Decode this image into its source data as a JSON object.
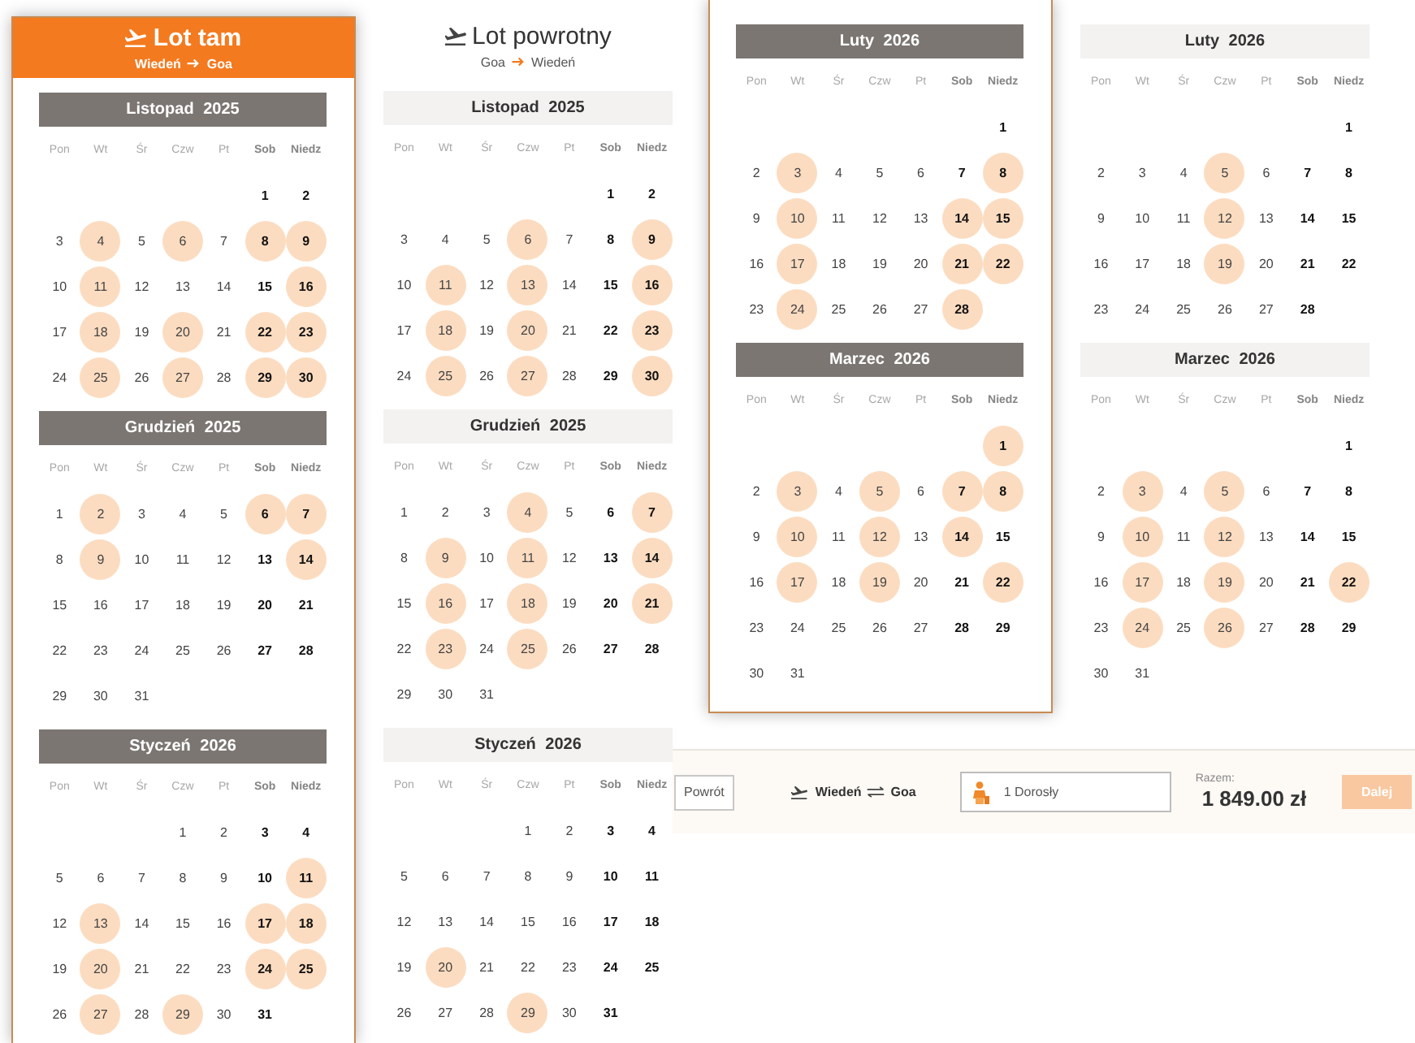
{
  "panels": [
    {
      "title": "Lot tam",
      "route": {
        "from": "Wiedeń",
        "to": "Goa"
      },
      "selected": true,
      "months": [
        {
          "title": "Listopad 2025",
          "weekdays": [
            "Pon",
            "Wt",
            "Śr",
            "Czw",
            "Pt",
            "Sob",
            "Niedz"
          ],
          "weeks": [
            [
              {
                "day": "1",
                "available": false
              },
              {
                "day": "2",
                "available": false
              }
            ],
            [
              {
                "day": "3",
                "available": false
              },
              {
                "day": "4",
                "available": true
              },
              {
                "day": "5",
                "available": false
              },
              {
                "day": "6",
                "available": true
              },
              {
                "day": "7",
                "available": false
              },
              {
                "day": "8",
                "available": true
              },
              {
                "day": "9",
                "available": true
              }
            ],
            [
              {
                "day": "10",
                "available": false
              },
              {
                "day": "11",
                "available": true
              },
              {
                "day": "12",
                "available": false
              },
              {
                "day": "13",
                "available": false
              },
              {
                "day": "14",
                "available": false
              },
              {
                "day": "15",
                "available": false
              },
              {
                "day": "16",
                "available": true
              }
            ],
            [
              {
                "day": "17",
                "available": false
              },
              {
                "day": "18",
                "available": true
              },
              {
                "day": "19",
                "available": false
              },
              {
                "day": "20",
                "available": true
              },
              {
                "day": "21",
                "available": false
              },
              {
                "day": "22",
                "available": true
              },
              {
                "day": "23",
                "available": true
              }
            ],
            [
              {
                "day": "24",
                "available": false
              },
              {
                "day": "25",
                "available": true
              },
              {
                "day": "26",
                "available": false
              },
              {
                "day": "27",
                "available": true
              },
              {
                "day": "28",
                "available": false
              },
              {
                "day": "29",
                "available": true
              },
              {
                "day": "30",
                "available": true
              }
            ]
          ]
        },
        {
          "title": "Grudzień 2025",
          "weekdays": [
            "Pon",
            "Wt",
            "Śr",
            "Czw",
            "Pt",
            "Sob",
            "Niedz"
          ],
          "weeks": [
            [
              {
                "day": "1",
                "available": false
              },
              {
                "day": "2",
                "available": true
              },
              {
                "day": "3",
                "available": false
              },
              {
                "day": "4",
                "available": false
              },
              {
                "day": "5",
                "available": false
              },
              {
                "day": "6",
                "available": true
              },
              {
                "day": "7",
                "available": true
              }
            ],
            [
              {
                "day": "8",
                "available": false
              },
              {
                "day": "9",
                "available": true
              },
              {
                "day": "10",
                "available": false
              },
              {
                "day": "11",
                "available": false
              },
              {
                "day": "12",
                "available": false
              },
              {
                "day": "13",
                "available": false
              },
              {
                "day": "14",
                "available": true
              }
            ],
            [
              {
                "day": "15",
                "available": false
              },
              {
                "day": "16",
                "available": false
              },
              {
                "day": "17",
                "available": false
              },
              {
                "day": "18",
                "available": false
              },
              {
                "day": "19",
                "available": false
              },
              {
                "day": "20",
                "available": false
              },
              {
                "day": "21",
                "available": false
              }
            ],
            [
              {
                "day": "22",
                "available": false
              },
              {
                "day": "23",
                "available": false
              },
              {
                "day": "24",
                "available": false
              },
              {
                "day": "25",
                "available": false
              },
              {
                "day": "26",
                "available": false
              },
              {
                "day": "27",
                "available": false
              },
              {
                "day": "28",
                "available": false
              }
            ],
            [
              {
                "day": "29",
                "available": false
              },
              {
                "day": "30",
                "available": false
              },
              {
                "day": "31",
                "available": false
              }
            ]
          ]
        },
        {
          "title": "Styczeń 2026",
          "weekdays": [
            "Pon",
            "Wt",
            "Śr",
            "Czw",
            "Pt",
            "Sob",
            "Niedz"
          ],
          "weeks": [
            [
              {
                "day": "1",
                "available": false
              },
              {
                "day": "2",
                "available": false
              },
              {
                "day": "3",
                "available": false
              },
              {
                "day": "4",
                "available": false
              }
            ],
            [
              {
                "day": "5",
                "available": false
              },
              {
                "day": "6",
                "available": false
              },
              {
                "day": "7",
                "available": false
              },
              {
                "day": "8",
                "available": false
              },
              {
                "day": "9",
                "available": false
              },
              {
                "day": "10",
                "available": false
              },
              {
                "day": "11",
                "available": true
              }
            ],
            [
              {
                "day": "12",
                "available": false
              },
              {
                "day": "13",
                "available": true
              },
              {
                "day": "14",
                "available": false
              },
              {
                "day": "15",
                "available": false
              },
              {
                "day": "16",
                "available": false
              },
              {
                "day": "17",
                "available": true
              },
              {
                "day": "18",
                "available": true
              }
            ],
            [
              {
                "day": "19",
                "available": false
              },
              {
                "day": "20",
                "available": true
              },
              {
                "day": "21",
                "available": false
              },
              {
                "day": "22",
                "available": false
              },
              {
                "day": "23",
                "available": false
              },
              {
                "day": "24",
                "available": true
              },
              {
                "day": "25",
                "available": true
              }
            ],
            [
              {
                "day": "26",
                "available": false
              },
              {
                "day": "27",
                "available": true
              },
              {
                "day": "28",
                "available": false
              },
              {
                "day": "29",
                "available": true
              },
              {
                "day": "30",
                "available": false
              },
              {
                "day": "31",
                "available": false
              }
            ]
          ]
        }
      ]
    },
    {
      "title": "Lot powrotny",
      "route": {
        "from": "Goa",
        "to": "Wiedeń"
      },
      "selected": false,
      "months": [
        {
          "title": "Listopad 2025",
          "weekdays": [
            "Pon",
            "Wt",
            "Śr",
            "Czw",
            "Pt",
            "Sob",
            "Niedz"
          ],
          "weeks": [
            [
              {
                "day": "1",
                "available": false
              },
              {
                "day": "2",
                "available": false
              }
            ],
            [
              {
                "day": "3",
                "available": false
              },
              {
                "day": "4",
                "available": false
              },
              {
                "day": "5",
                "available": false
              },
              {
                "day": "6",
                "available": true
              },
              {
                "day": "7",
                "available": false
              },
              {
                "day": "8",
                "available": false
              },
              {
                "day": "9",
                "available": true
              }
            ],
            [
              {
                "day": "10",
                "available": false
              },
              {
                "day": "11",
                "available": true
              },
              {
                "day": "12",
                "available": false
              },
              {
                "day": "13",
                "available": true
              },
              {
                "day": "14",
                "available": false
              },
              {
                "day": "15",
                "available": false
              },
              {
                "day": "16",
                "available": true
              }
            ],
            [
              {
                "day": "17",
                "available": false
              },
              {
                "day": "18",
                "available": true
              },
              {
                "day": "19",
                "available": false
              },
              {
                "day": "20",
                "available": true
              },
              {
                "day": "21",
                "available": false
              },
              {
                "day": "22",
                "available": false
              },
              {
                "day": "23",
                "available": true
              }
            ],
            [
              {
                "day": "24",
                "available": false
              },
              {
                "day": "25",
                "available": true
              },
              {
                "day": "26",
                "available": false
              },
              {
                "day": "27",
                "available": true
              },
              {
                "day": "28",
                "available": false
              },
              {
                "day": "29",
                "available": false
              },
              {
                "day": "30",
                "available": true
              }
            ]
          ]
        },
        {
          "title": "Grudzień 2025",
          "weekdays": [
            "Pon",
            "Wt",
            "Śr",
            "Czw",
            "Pt",
            "Sob",
            "Niedz"
          ],
          "weeks": [
            [
              {
                "day": "1",
                "available": false
              },
              {
                "day": "2",
                "available": false
              },
              {
                "day": "3",
                "available": false
              },
              {
                "day": "4",
                "available": true
              },
              {
                "day": "5",
                "available": false
              },
              {
                "day": "6",
                "available": false
              },
              {
                "day": "7",
                "available": true
              }
            ],
            [
              {
                "day": "8",
                "available": false
              },
              {
                "day": "9",
                "available": true
              },
              {
                "day": "10",
                "available": false
              },
              {
                "day": "11",
                "available": true
              },
              {
                "day": "12",
                "available": false
              },
              {
                "day": "13",
                "available": false
              },
              {
                "day": "14",
                "available": true
              }
            ],
            [
              {
                "day": "15",
                "available": false
              },
              {
                "day": "16",
                "available": true
              },
              {
                "day": "17",
                "available": false
              },
              {
                "day": "18",
                "available": true
              },
              {
                "day": "19",
                "available": false
              },
              {
                "day": "20",
                "available": false
              },
              {
                "day": "21",
                "available": true
              }
            ],
            [
              {
                "day": "22",
                "available": false
              },
              {
                "day": "23",
                "available": true
              },
              {
                "day": "24",
                "available": false
              },
              {
                "day": "25",
                "available": true
              },
              {
                "day": "26",
                "available": false
              },
              {
                "day": "27",
                "available": false
              },
              {
                "day": "28",
                "available": false
              }
            ],
            [
              {
                "day": "29",
                "available": false
              },
              {
                "day": "30",
                "available": false
              },
              {
                "day": "31",
                "available": false
              }
            ]
          ]
        },
        {
          "title": "Styczeń 2026",
          "weekdays": [
            "Pon",
            "Wt",
            "Śr",
            "Czw",
            "Pt",
            "Sob",
            "Niedz"
          ],
          "weeks": [
            [
              {
                "day": "1",
                "available": false
              },
              {
                "day": "2",
                "available": false
              },
              {
                "day": "3",
                "available": false
              },
              {
                "day": "4",
                "available": false
              }
            ],
            [
              {
                "day": "5",
                "available": false
              },
              {
                "day": "6",
                "available": false
              },
              {
                "day": "7",
                "available": false
              },
              {
                "day": "8",
                "available": false
              },
              {
                "day": "9",
                "available": false
              },
              {
                "day": "10",
                "available": false
              },
              {
                "day": "11",
                "available": false
              }
            ],
            [
              {
                "day": "12",
                "available": false
              },
              {
                "day": "13",
                "available": false
              },
              {
                "day": "14",
                "available": false
              },
              {
                "day": "15",
                "available": false
              },
              {
                "day": "16",
                "available": false
              },
              {
                "day": "17",
                "available": false
              },
              {
                "day": "18",
                "available": false
              }
            ],
            [
              {
                "day": "19",
                "available": false
              },
              {
                "day": "20",
                "available": true
              },
              {
                "day": "21",
                "available": false
              },
              {
                "day": "22",
                "available": false
              },
              {
                "day": "23",
                "available": false
              },
              {
                "day": "24",
                "available": false
              },
              {
                "day": "25",
                "available": false
              }
            ],
            [
              {
                "day": "26",
                "available": false
              },
              {
                "day": "27",
                "available": false
              },
              {
                "day": "28",
                "available": false
              },
              {
                "day": "29",
                "available": true
              },
              {
                "day": "30",
                "available": false
              },
              {
                "day": "31",
                "available": false
              }
            ]
          ]
        }
      ]
    },
    {
      "selected": true,
      "months": [
        {
          "title": "Luty 2026",
          "weekdays": [
            "Pon",
            "Wt",
            "Śr",
            "Czw",
            "Pt",
            "Sob",
            "Niedz"
          ],
          "weeks": [
            [
              {
                "day": "1",
                "available": false
              }
            ],
            [
              {
                "day": "2",
                "available": false
              },
              {
                "day": "3",
                "available": true
              },
              {
                "day": "4",
                "available": false
              },
              {
                "day": "5",
                "available": false
              },
              {
                "day": "6",
                "available": false
              },
              {
                "day": "7",
                "available": false
              },
              {
                "day": "8",
                "available": true
              }
            ],
            [
              {
                "day": "9",
                "available": false
              },
              {
                "day": "10",
                "available": true
              },
              {
                "day": "11",
                "available": false
              },
              {
                "day": "12",
                "available": false
              },
              {
                "day": "13",
                "available": false
              },
              {
                "day": "14",
                "available": true
              },
              {
                "day": "15",
                "available": true
              }
            ],
            [
              {
                "day": "16",
                "available": false
              },
              {
                "day": "17",
                "available": true
              },
              {
                "day": "18",
                "available": false
              },
              {
                "day": "19",
                "available": false
              },
              {
                "day": "20",
                "available": false
              },
              {
                "day": "21",
                "available": true
              },
              {
                "day": "22",
                "available": true
              }
            ],
            [
              {
                "day": "23",
                "available": false
              },
              {
                "day": "24",
                "available": true
              },
              {
                "day": "25",
                "available": false
              },
              {
                "day": "26",
                "available": false
              },
              {
                "day": "27",
                "available": false
              },
              {
                "day": "28",
                "available": true
              }
            ]
          ]
        },
        {
          "title": "Marzec 2026",
          "weekdays": [
            "Pon",
            "Wt",
            "Śr",
            "Czw",
            "Pt",
            "Sob",
            "Niedz"
          ],
          "weeks": [
            [
              {
                "day": "1",
                "available": true
              }
            ],
            [
              {
                "day": "2",
                "available": false
              },
              {
                "day": "3",
                "available": true
              },
              {
                "day": "4",
                "available": false
              },
              {
                "day": "5",
                "available": true
              },
              {
                "day": "6",
                "available": false
              },
              {
                "day": "7",
                "available": true
              },
              {
                "day": "8",
                "available": true
              }
            ],
            [
              {
                "day": "9",
                "available": false
              },
              {
                "day": "10",
                "available": true
              },
              {
                "day": "11",
                "available": false
              },
              {
                "day": "12",
                "available": true
              },
              {
                "day": "13",
                "available": false
              },
              {
                "day": "14",
                "available": true
              },
              {
                "day": "15",
                "available": false
              }
            ],
            [
              {
                "day": "16",
                "available": false
              },
              {
                "day": "17",
                "available": true
              },
              {
                "day": "18",
                "available": false
              },
              {
                "day": "19",
                "available": true
              },
              {
                "day": "20",
                "available": false
              },
              {
                "day": "21",
                "available": false
              },
              {
                "day": "22",
                "available": true
              }
            ],
            [
              {
                "day": "23",
                "available": false
              },
              {
                "day": "24",
                "available": false
              },
              {
                "day": "25",
                "available": false
              },
              {
                "day": "26",
                "available": false
              },
              {
                "day": "27",
                "available": false
              },
              {
                "day": "28",
                "available": false
              },
              {
                "day": "29",
                "available": false
              }
            ],
            [
              {
                "day": "30",
                "available": false
              },
              {
                "day": "31",
                "available": false
              }
            ]
          ]
        }
      ]
    },
    {
      "selected": false,
      "months": [
        {
          "title": "Luty 2026",
          "weekdays": [
            "Pon",
            "Wt",
            "Śr",
            "Czw",
            "Pt",
            "Sob",
            "Niedz"
          ],
          "weeks": [
            [
              {
                "day": "1",
                "available": false
              }
            ],
            [
              {
                "day": "2",
                "available": false
              },
              {
                "day": "3",
                "available": false
              },
              {
                "day": "4",
                "available": false
              },
              {
                "day": "5",
                "available": true
              },
              {
                "day": "6",
                "available": false
              },
              {
                "day": "7",
                "available": false
              },
              {
                "day": "8",
                "available": false
              }
            ],
            [
              {
                "day": "9",
                "available": false
              },
              {
                "day": "10",
                "available": false
              },
              {
                "day": "11",
                "available": false
              },
              {
                "day": "12",
                "available": true
              },
              {
                "day": "13",
                "available": false
              },
              {
                "day": "14",
                "available": false
              },
              {
                "day": "15",
                "available": false
              }
            ],
            [
              {
                "day": "16",
                "available": false
              },
              {
                "day": "17",
                "available": false
              },
              {
                "day": "18",
                "available": false
              },
              {
                "day": "19",
                "available": true
              },
              {
                "day": "20",
                "available": false
              },
              {
                "day": "21",
                "available": false
              },
              {
                "day": "22",
                "available": false
              }
            ],
            [
              {
                "day": "23",
                "available": false
              },
              {
                "day": "24",
                "available": false
              },
              {
                "day": "25",
                "available": false
              },
              {
                "day": "26",
                "available": false
              },
              {
                "day": "27",
                "available": false
              },
              {
                "day": "28",
                "available": false
              }
            ]
          ]
        },
        {
          "title": "Marzec 2026",
          "weekdays": [
            "Pon",
            "Wt",
            "Śr",
            "Czw",
            "Pt",
            "Sob",
            "Niedz"
          ],
          "weeks": [
            [
              {
                "day": "1",
                "available": false
              }
            ],
            [
              {
                "day": "2",
                "available": false
              },
              {
                "day": "3",
                "available": true
              },
              {
                "day": "4",
                "available": false
              },
              {
                "day": "5",
                "available": true
              },
              {
                "day": "6",
                "available": false
              },
              {
                "day": "7",
                "available": false
              },
              {
                "day": "8",
                "available": false
              }
            ],
            [
              {
                "day": "9",
                "available": false
              },
              {
                "day": "10",
                "available": true
              },
              {
                "day": "11",
                "available": false
              },
              {
                "day": "12",
                "available": true
              },
              {
                "day": "13",
                "available": false
              },
              {
                "day": "14",
                "available": false
              },
              {
                "day": "15",
                "available": false
              }
            ],
            [
              {
                "day": "16",
                "available": false
              },
              {
                "day": "17",
                "available": true
              },
              {
                "day": "18",
                "available": false
              },
              {
                "day": "19",
                "available": true
              },
              {
                "day": "20",
                "available": false
              },
              {
                "day": "21",
                "available": false
              },
              {
                "day": "22",
                "available": true
              }
            ],
            [
              {
                "day": "23",
                "available": false
              },
              {
                "day": "24",
                "available": true
              },
              {
                "day": "25",
                "available": false
              },
              {
                "day": "26",
                "available": true
              },
              {
                "day": "27",
                "available": false
              },
              {
                "day": "28",
                "available": false
              },
              {
                "day": "29",
                "available": false
              }
            ],
            [
              {
                "day": "30",
                "available": false
              },
              {
                "day": "31",
                "available": false
              }
            ]
          ]
        }
      ]
    }
  ],
  "booking_bar": {
    "back_button": "Powrót",
    "route": {
      "from": "Wiedeń",
      "to": "Goa"
    },
    "passengers": {
      "value": "1 Dorosły"
    },
    "total": {
      "label": "Razem:",
      "amount": "1 849.00 zł"
    },
    "next_button": {
      "label": "Dalej",
      "disabled": true
    }
  }
}
